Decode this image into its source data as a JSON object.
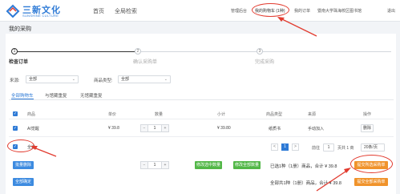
{
  "header": {
    "logo_cn": "三新文化",
    "logo_en": "SUNSHINE CULTURE",
    "nav": [
      "首页",
      "全局检索"
    ],
    "right_links": [
      "管理后台",
      "我的购物车 (1种)",
      "我的订单",
      "暨南大学珠海校区图书馆",
      "退出"
    ]
  },
  "page_title": "我的采购",
  "steps": [
    {
      "num": "1",
      "label": "检查订单",
      "active": true
    },
    {
      "num": "2",
      "label": "确认采购单",
      "active": false
    },
    {
      "num": "3",
      "label": "完成采购",
      "active": false
    }
  ],
  "filters": {
    "source_label": "来源:",
    "source_value": "全部",
    "type_label": "商品类型:",
    "type_value": "全部"
  },
  "tabs": [
    "全部购物车",
    "与馆藏重复",
    "无馆藏重复"
  ],
  "table": {
    "headers": [
      "商品",
      "单价",
      "数量",
      "小计",
      "商品类型",
      "来源",
      "操作"
    ],
    "rows": [
      {
        "name": "AI觉醒",
        "price": "¥ 39.8",
        "qty": "1",
        "subtotal": "¥ 39.80",
        "type": "纸质书",
        "source": "手动加入",
        "action": "删除"
      }
    ]
  },
  "select_all_label": "全选",
  "pagination": {
    "prev": "<",
    "page": "1",
    "next": ">",
    "goto_label": "前往",
    "goto_value": "1",
    "total_label": "页共 1 商",
    "per_page": "20条/页"
  },
  "actions": {
    "batch_delete": "批量删除",
    "qty_value": "1",
    "modify_selected": "修改选中数量",
    "modify_all": "修改全部数量",
    "selected_summary": "已选1种（1册）商品，合计 ¥ 39.8",
    "submit_selected": "提交所选采购单",
    "select_all_btn": "全部确定",
    "total_summary": "全部共1种（1册）商品，合计 ¥ 39.8",
    "submit_all": "提交全部采购单"
  },
  "colors": {
    "brand": "#2d7ad6",
    "annotation": "#e23b2f",
    "submit": "#f0932b",
    "modify": "#52b747"
  }
}
